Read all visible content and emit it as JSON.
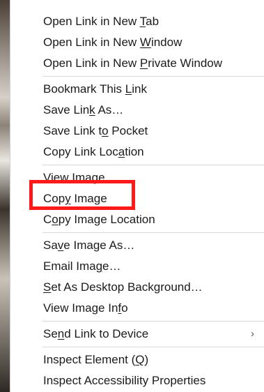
{
  "menu": {
    "groups": [
      [
        {
          "pre": "Open Link in New ",
          "acc": "T",
          "post": "ab"
        },
        {
          "pre": "Open Link in New ",
          "acc": "W",
          "post": "indow"
        },
        {
          "pre": "Open Link in New ",
          "acc": "P",
          "post": "rivate Window"
        }
      ],
      [
        {
          "pre": "Bookmark This ",
          "acc": "L",
          "post": "ink"
        },
        {
          "pre": "Save Lin",
          "acc": "k",
          "post": " As…"
        },
        {
          "pre": "Save Link t",
          "acc": "o",
          "post": " Pocket"
        },
        {
          "pre": "Copy Link Loc",
          "acc": "a",
          "post": "tion"
        }
      ],
      [
        {
          "pre": "View Ima",
          "acc": "g",
          "post": "e"
        },
        {
          "pre": "Cop",
          "acc": "y",
          "post": " Image"
        },
        {
          "pre": "C",
          "acc": "o",
          "post": "py Image Location"
        }
      ],
      [
        {
          "pre": "Sa",
          "acc": "v",
          "post": "e Image As…"
        },
        {
          "pre": "Email Ima",
          "acc": "g",
          "post": "e…"
        },
        {
          "pre": "",
          "acc": "S",
          "post": "et As Desktop Background…"
        },
        {
          "pre": "View Image In",
          "acc": "f",
          "post": "o"
        }
      ],
      [
        {
          "pre": "Se",
          "acc": "n",
          "post": "d Link to Device",
          "submenu_arrow": "›"
        }
      ],
      [
        {
          "pre": "Inspect Element (",
          "acc": "Q",
          "post": ")"
        },
        {
          "pre": "Inspect Accessibility Properties",
          "acc": "",
          "post": ""
        }
      ]
    ],
    "highlight_color": "#ff1a1a"
  }
}
